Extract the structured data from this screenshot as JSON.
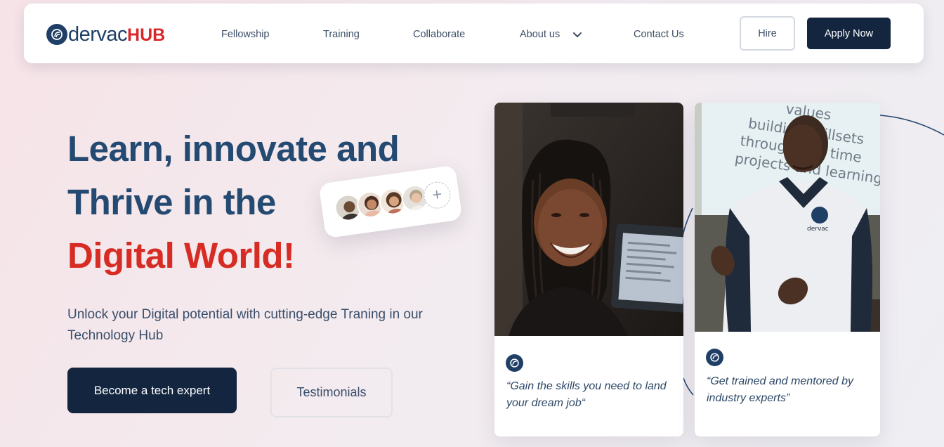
{
  "brand": {
    "logo_a": "dervac",
    "logo_b": "HUB"
  },
  "nav": {
    "items": [
      "Fellowship",
      "Training",
      "Collaborate",
      "About us",
      "Contact Us"
    ],
    "hire_label": "Hire",
    "apply_label": "Apply Now"
  },
  "hero": {
    "line1": "Learn, innovate and",
    "line2": "Thrive in the",
    "line3": "Digital World!",
    "subtext": "Unlock your Digital potential with cutting-edge Traning in our Technology Hub",
    "primary_cta": "Become a tech expert",
    "secondary_cta": "Testimonials",
    "add_symbol": "+"
  },
  "cards": [
    {
      "quote": "“Gain the skills you need to land your dream job“"
    },
    {
      "quote": "“Get trained and mentored by industry experts”"
    }
  ],
  "slide_text": [
    "values",
    "building skillsets",
    "through real time",
    "projects and learning"
  ],
  "shirt_text": "dervac",
  "colors": {
    "navy": "#14253f",
    "brand_blue": "#244a72",
    "brand_red": "#d62c24"
  }
}
